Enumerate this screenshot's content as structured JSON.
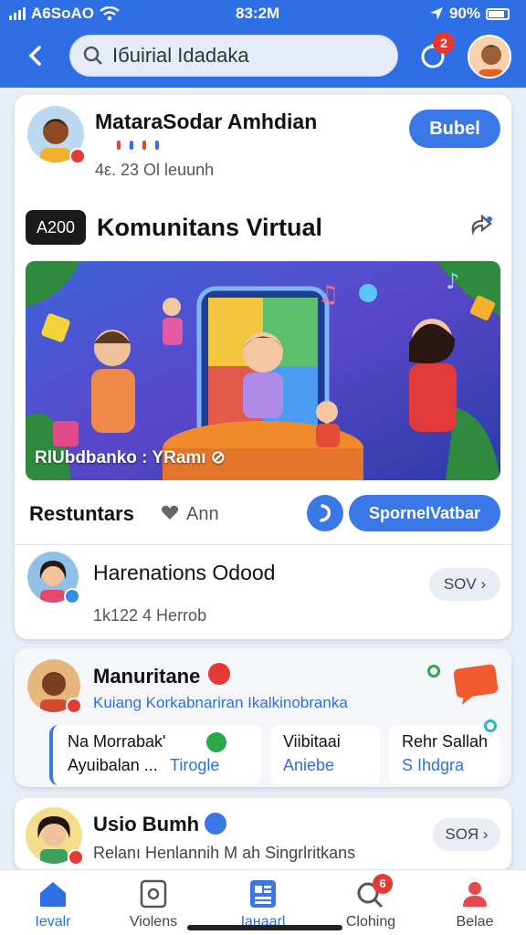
{
  "status": {
    "carrier": "A6SoAO",
    "time": "83:2M",
    "battery": "90%"
  },
  "search": {
    "value": "Iбuirial Idadaka",
    "notification_count": "2"
  },
  "post": {
    "author": "MatarаSodar Amhdian",
    "meta": "4ε. 23  Ol leuunh",
    "action": "Bubel",
    "tag": "A200",
    "title": "Komunitans Virtual",
    "image_caption": "RlUbdbanko : YRamı ⊘",
    "footer_label": "Restuntars",
    "like_label": "Ann",
    "primary_action": "SpornelVatbar"
  },
  "comment": {
    "name": "Harenations Odood",
    "meta": "1k122  4 Herrob",
    "button": "SOV ›"
  },
  "group": {
    "name": "Manuritane",
    "subtitle": "Kuiang Korkabnariran  Ikalkinobranka",
    "tiles": [
      {
        "title": "Na Morrabak'",
        "subtitle": "Ayuibalan ...",
        "link": "Tirogle"
      },
      {
        "title": "Viibitaai",
        "subtitle": "Aniebe",
        "link": ""
      },
      {
        "title": "Rehr Sallah",
        "subtitle": "S Ihdgra",
        "link": ""
      }
    ]
  },
  "last_post": {
    "name": "Usio Bumh",
    "text": "Relanı Henlannih M ah Singrlritkans",
    "button": "SOЯ ›"
  },
  "nav": [
    {
      "label": "Ievalr",
      "icon": "home-icon",
      "active": true
    },
    {
      "label": "Violens",
      "icon": "video-icon",
      "active": false
    },
    {
      "label": "Iaнaarl",
      "icon": "feed-icon",
      "active": false
    },
    {
      "label": "Clohing",
      "icon": "search-icon",
      "active": false,
      "badge": "6"
    },
    {
      "label": "Belae",
      "icon": "profile-icon",
      "active": false
    }
  ],
  "colors": {
    "primary": "#2f6fe6",
    "accent": "#3b78e7",
    "badge": "#e53935"
  }
}
